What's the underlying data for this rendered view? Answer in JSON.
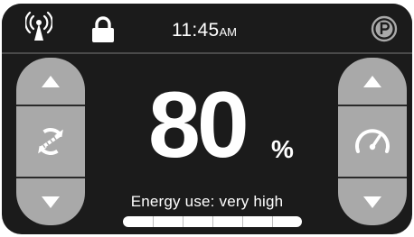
{
  "status_bar": {
    "time": "11:45",
    "time_suffix": "AM",
    "icons": [
      "antenna-signal-icon",
      "lock-icon",
      "parking-brake-icon"
    ]
  },
  "display": {
    "percentage": "80",
    "percent_sign": "%"
  },
  "left_control": {
    "up_icon": "up-arrow-icon",
    "center_icon": "rotate-arrows-icon",
    "down_icon": "down-arrow-icon"
  },
  "right_control": {
    "up_icon": "up-arrow-icon",
    "center_icon": "speedometer-icon",
    "down_icon": "down-arrow-icon"
  },
  "energy": {
    "label": "Energy use: very high",
    "level": 1.0
  },
  "colors": {
    "background": "#1b1b1b",
    "button": "#a9a9a9",
    "text": "#ffffff"
  }
}
